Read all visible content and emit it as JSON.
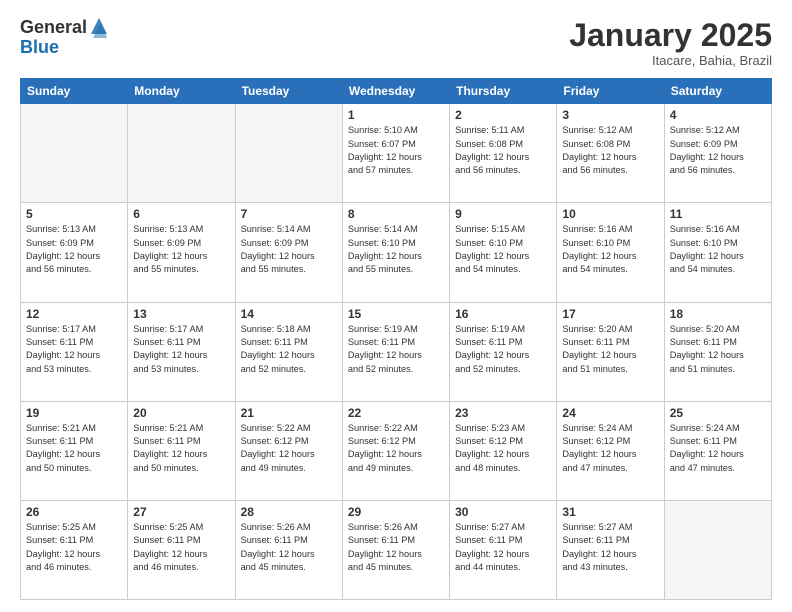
{
  "logo": {
    "general": "General",
    "blue": "Blue"
  },
  "header": {
    "month": "January 2025",
    "location": "Itacare, Bahia, Brazil"
  },
  "days_of_week": [
    "Sunday",
    "Monday",
    "Tuesday",
    "Wednesday",
    "Thursday",
    "Friday",
    "Saturday"
  ],
  "weeks": [
    [
      {
        "day": "",
        "info": "",
        "empty": true
      },
      {
        "day": "",
        "info": "",
        "empty": true
      },
      {
        "day": "",
        "info": "",
        "empty": true
      },
      {
        "day": "1",
        "info": "Sunrise: 5:10 AM\nSunset: 6:07 PM\nDaylight: 12 hours\nand 57 minutes."
      },
      {
        "day": "2",
        "info": "Sunrise: 5:11 AM\nSunset: 6:08 PM\nDaylight: 12 hours\nand 56 minutes."
      },
      {
        "day": "3",
        "info": "Sunrise: 5:12 AM\nSunset: 6:08 PM\nDaylight: 12 hours\nand 56 minutes."
      },
      {
        "day": "4",
        "info": "Sunrise: 5:12 AM\nSunset: 6:09 PM\nDaylight: 12 hours\nand 56 minutes."
      }
    ],
    [
      {
        "day": "5",
        "info": "Sunrise: 5:13 AM\nSunset: 6:09 PM\nDaylight: 12 hours\nand 56 minutes."
      },
      {
        "day": "6",
        "info": "Sunrise: 5:13 AM\nSunset: 6:09 PM\nDaylight: 12 hours\nand 55 minutes."
      },
      {
        "day": "7",
        "info": "Sunrise: 5:14 AM\nSunset: 6:09 PM\nDaylight: 12 hours\nand 55 minutes."
      },
      {
        "day": "8",
        "info": "Sunrise: 5:14 AM\nSunset: 6:10 PM\nDaylight: 12 hours\nand 55 minutes."
      },
      {
        "day": "9",
        "info": "Sunrise: 5:15 AM\nSunset: 6:10 PM\nDaylight: 12 hours\nand 54 minutes."
      },
      {
        "day": "10",
        "info": "Sunrise: 5:16 AM\nSunset: 6:10 PM\nDaylight: 12 hours\nand 54 minutes."
      },
      {
        "day": "11",
        "info": "Sunrise: 5:16 AM\nSunset: 6:10 PM\nDaylight: 12 hours\nand 54 minutes."
      }
    ],
    [
      {
        "day": "12",
        "info": "Sunrise: 5:17 AM\nSunset: 6:11 PM\nDaylight: 12 hours\nand 53 minutes."
      },
      {
        "day": "13",
        "info": "Sunrise: 5:17 AM\nSunset: 6:11 PM\nDaylight: 12 hours\nand 53 minutes."
      },
      {
        "day": "14",
        "info": "Sunrise: 5:18 AM\nSunset: 6:11 PM\nDaylight: 12 hours\nand 52 minutes."
      },
      {
        "day": "15",
        "info": "Sunrise: 5:19 AM\nSunset: 6:11 PM\nDaylight: 12 hours\nand 52 minutes."
      },
      {
        "day": "16",
        "info": "Sunrise: 5:19 AM\nSunset: 6:11 PM\nDaylight: 12 hours\nand 52 minutes."
      },
      {
        "day": "17",
        "info": "Sunrise: 5:20 AM\nSunset: 6:11 PM\nDaylight: 12 hours\nand 51 minutes."
      },
      {
        "day": "18",
        "info": "Sunrise: 5:20 AM\nSunset: 6:11 PM\nDaylight: 12 hours\nand 51 minutes."
      }
    ],
    [
      {
        "day": "19",
        "info": "Sunrise: 5:21 AM\nSunset: 6:11 PM\nDaylight: 12 hours\nand 50 minutes."
      },
      {
        "day": "20",
        "info": "Sunrise: 5:21 AM\nSunset: 6:11 PM\nDaylight: 12 hours\nand 50 minutes."
      },
      {
        "day": "21",
        "info": "Sunrise: 5:22 AM\nSunset: 6:12 PM\nDaylight: 12 hours\nand 49 minutes."
      },
      {
        "day": "22",
        "info": "Sunrise: 5:22 AM\nSunset: 6:12 PM\nDaylight: 12 hours\nand 49 minutes."
      },
      {
        "day": "23",
        "info": "Sunrise: 5:23 AM\nSunset: 6:12 PM\nDaylight: 12 hours\nand 48 minutes."
      },
      {
        "day": "24",
        "info": "Sunrise: 5:24 AM\nSunset: 6:12 PM\nDaylight: 12 hours\nand 47 minutes."
      },
      {
        "day": "25",
        "info": "Sunrise: 5:24 AM\nSunset: 6:11 PM\nDaylight: 12 hours\nand 47 minutes."
      }
    ],
    [
      {
        "day": "26",
        "info": "Sunrise: 5:25 AM\nSunset: 6:11 PM\nDaylight: 12 hours\nand 46 minutes."
      },
      {
        "day": "27",
        "info": "Sunrise: 5:25 AM\nSunset: 6:11 PM\nDaylight: 12 hours\nand 46 minutes."
      },
      {
        "day": "28",
        "info": "Sunrise: 5:26 AM\nSunset: 6:11 PM\nDaylight: 12 hours\nand 45 minutes."
      },
      {
        "day": "29",
        "info": "Sunrise: 5:26 AM\nSunset: 6:11 PM\nDaylight: 12 hours\nand 45 minutes."
      },
      {
        "day": "30",
        "info": "Sunrise: 5:27 AM\nSunset: 6:11 PM\nDaylight: 12 hours\nand 44 minutes."
      },
      {
        "day": "31",
        "info": "Sunrise: 5:27 AM\nSunset: 6:11 PM\nDaylight: 12 hours\nand 43 minutes."
      },
      {
        "day": "",
        "info": "",
        "empty": true
      }
    ]
  ]
}
